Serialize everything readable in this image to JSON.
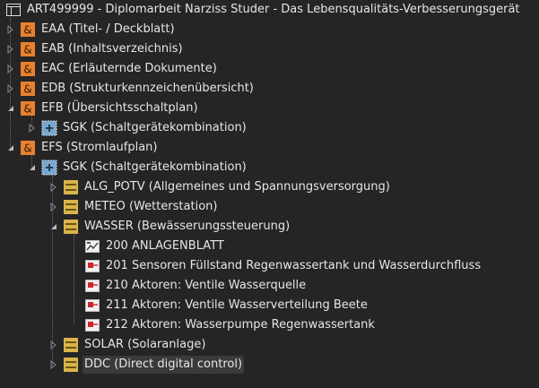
{
  "root": {
    "label": "ART499999 - Diplomarbeit Narziss Studer - Das Lebensqualitäts-Verbesserungsgerät"
  },
  "tree": {
    "eaa": "EAA (Titel- / Deckblatt)",
    "eab": "EAB (Inhaltsverzeichnis)",
    "eac": "EAC (Erläuternde Dokumente)",
    "edb": "EDB (Strukturkennzeichenübersicht)",
    "efb": "EFB (Übersichtsschaltplan)",
    "efb_sgk": "SGK (Schaltgerätekombination)",
    "efs": "EFS (Stromlaufplan)",
    "efs_sgk": "SGK (Schaltgerätekombination)",
    "alg_potv": "ALG_POTV (Allgemeines und Spannungsversorgung)",
    "meteo": "METEO (Wetterstation)",
    "wasser": "WASSER (Bewässerungssteuerung)",
    "p200": "200 ANLAGENBLATT",
    "p201": "201 Sensoren Füllstand Regenwassertank und Wasserdurchfluss",
    "p210": "210 Aktoren: Ventile Wasserquelle",
    "p211": "211 Aktoren: Ventile Wasserverteilung Beete",
    "p212": "212 Aktoren: Wasserpumpe Regenwassertank",
    "solar": "SOLAR (Solaranlage)",
    "ddc": "DDC (Direct digital control)"
  },
  "colors": {
    "background": "#252526",
    "text": "#e6e6e6",
    "group_icon": "#e8812f",
    "sgk_icon": "#7aa6cc",
    "folder_icon": "#d9b44a",
    "page_icon_red": "#d0242a",
    "selection": "#3a3a3a"
  },
  "icons": {
    "root": "window-icon",
    "group": "ampersand-group-icon",
    "sgk": "cabinet-plus-icon",
    "folder": "stripes-folder-icon",
    "page_chart": "chart-page-icon",
    "page_schematic": "schematic-page-icon"
  }
}
